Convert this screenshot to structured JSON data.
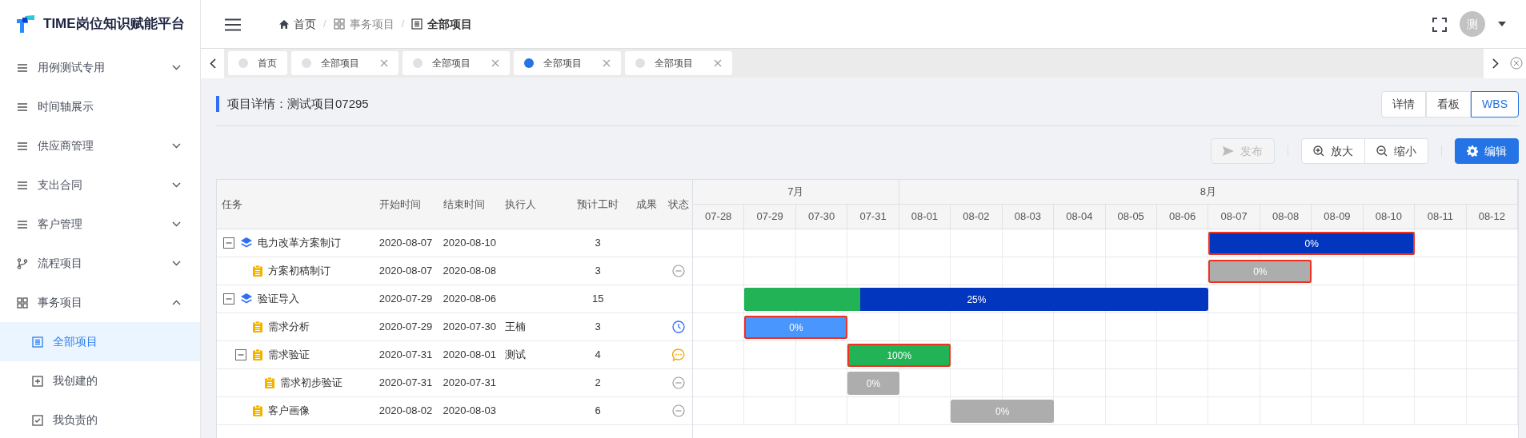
{
  "app": {
    "title": "TIME岗位知识赋能平台"
  },
  "sidebar": {
    "items": [
      {
        "label": "用例测试专用",
        "expanded": false
      },
      {
        "label": "时间轴展示"
      },
      {
        "label": "供应商管理",
        "expanded": false
      },
      {
        "label": "支出合同",
        "expanded": false
      },
      {
        "label": "客户管理",
        "expanded": false
      },
      {
        "label": "流程项目",
        "expanded": false
      },
      {
        "label": "事务项目",
        "expanded": true,
        "children": [
          {
            "label": "全部项目",
            "selected": true
          },
          {
            "label": "我创建的",
            "selected": false
          },
          {
            "label": "我负责的",
            "selected": false
          }
        ]
      }
    ]
  },
  "breadcrumb": [
    {
      "label": "首页",
      "current": false
    },
    {
      "separator": "/",
      "label": "事务项目",
      "current": false
    },
    {
      "separator": "/",
      "label": "全部项目",
      "current": true
    }
  ],
  "user": {
    "avatar": "测"
  },
  "tabs": [
    {
      "label": "首页",
      "selected": false,
      "closable": false
    },
    {
      "label": "全部项目",
      "selected": false,
      "closable": true
    },
    {
      "label": "全部项目",
      "selected": false,
      "closable": true
    },
    {
      "label": "全部项目",
      "selected": true,
      "closable": true
    },
    {
      "label": "全部项目",
      "selected": false,
      "closable": true
    }
  ],
  "page_title": "项目详情：测试项目07295",
  "views": [
    {
      "label": "详情",
      "selected": false
    },
    {
      "label": "看板",
      "selected": false
    },
    {
      "label": "WBS",
      "selected": true
    }
  ],
  "toolbar": [
    {
      "label": "发布",
      "kind": "publish",
      "disabled": true
    },
    {
      "label": "放大",
      "kind": "zoom-in",
      "disabled": false
    },
    {
      "label": "缩小",
      "kind": "zoom-out",
      "disabled": false
    },
    {
      "label": "编辑",
      "kind": "edit",
      "disabled": false
    }
  ],
  "table": {
    "columns": [
      "任务",
      "开始时间",
      "结束时间",
      "执行人",
      "预计工时",
      "成果",
      "状态"
    ],
    "rows": [
      {
        "kind": "group",
        "name": "电力改革方案制订",
        "start": "2020-08-07",
        "end": "2020-08-10",
        "hours": "3",
        "expanded": true,
        "bar": {
          "label": "0%",
          "color": "#0336bf",
          "critical": true
        },
        "children": [
          {
            "kind": "task",
            "name": "方案初稿制订",
            "start": "2020-08-07",
            "end": "2020-08-08",
            "hours": "3",
            "status_icon": {
              "kind": "pending"
            },
            "bar": {
              "label": "0%",
              "color": "#adadad",
              "critical": true
            }
          }
        ]
      },
      {
        "kind": "group",
        "name": "验证导入",
        "start": "2020-07-29",
        "end": "2020-08-06",
        "hours": "15",
        "expanded": true,
        "bar": {
          "label": "25%",
          "level": 0.25,
          "color": "#0336bf",
          "critical": false
        },
        "children": [
          {
            "kind": "task",
            "name": "需求分析",
            "start": "2020-07-29",
            "end": "2020-07-30",
            "assignee": "王楠",
            "hours": "3",
            "status_icon": {
              "kind": "in-progress"
            },
            "bar": {
              "label": "0%",
              "color": "#4a96ff",
              "critical": true
            }
          },
          {
            "kind": "task",
            "name": "需求验证",
            "start": "2020-07-31",
            "end": "2020-08-01",
            "assignee": "测试",
            "hours": "4",
            "status_icon": {
              "kind": "feedback"
            },
            "expanded": true,
            "bar": {
              "label": "100%",
              "color": "#21b355",
              "critical": true
            },
            "children": [
              {
                "kind": "task",
                "name": "需求初步验证",
                "start": "2020-07-31",
                "end": "2020-07-31",
                "hours": "2",
                "status_icon": {
                  "kind": "pending"
                },
                "bar": {
                  "label": "0%",
                  "color": "#adadad",
                  "critical": false
                }
              }
            ]
          },
          {
            "kind": "task",
            "name": "客户画像",
            "start": "2020-08-02",
            "end": "2020-08-03",
            "hours": "6",
            "status_icon": {
              "kind": "pending"
            },
            "bar": {
              "label": "0%",
              "color": "#adadad",
              "critical": false
            }
          }
        ]
      }
    ]
  },
  "gantt": {
    "months": [
      {
        "label": "7月",
        "days": [
          "07-28",
          "07-29",
          "07-30",
          "07-31"
        ]
      },
      {
        "label": "8月",
        "days": [
          "08-01",
          "08-02",
          "08-03",
          "08-04",
          "08-05",
          "08-06",
          "08-07",
          "08-08",
          "08-09",
          "08-10",
          "08-11",
          "08-12"
        ]
      }
    ]
  }
}
